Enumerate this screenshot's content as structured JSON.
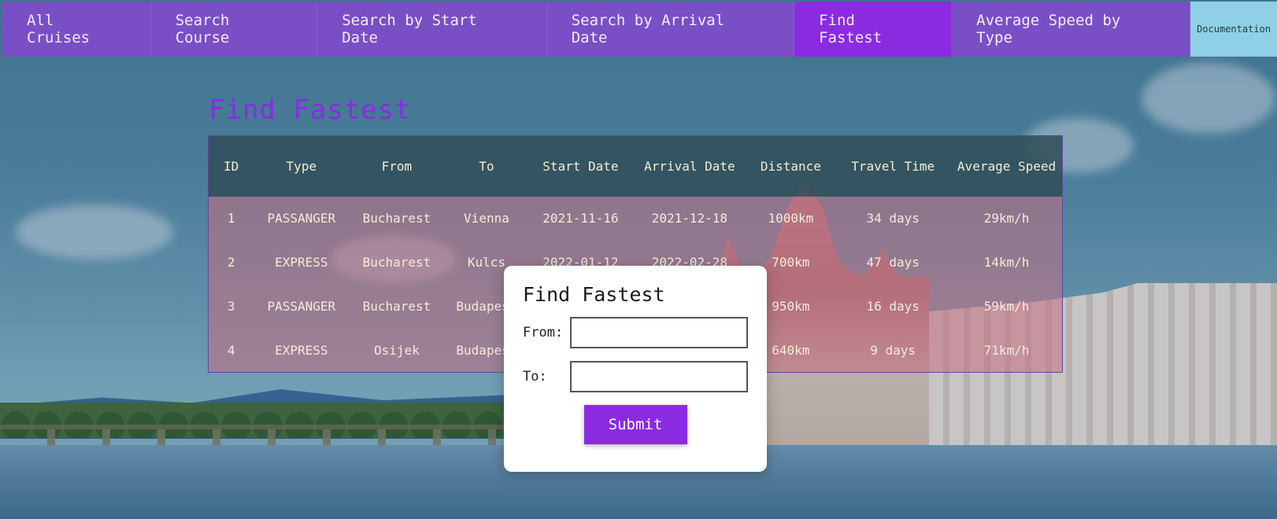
{
  "nav": {
    "items": [
      {
        "label": "All Cruises"
      },
      {
        "label": "Search Course"
      },
      {
        "label": "Search by Start Date"
      },
      {
        "label": "Search by Arrival Date"
      },
      {
        "label": "Find Fastest",
        "active": true
      },
      {
        "label": "Average Speed by Type"
      }
    ],
    "documentation_label": "Documentation"
  },
  "page": {
    "title": "Find Fastest"
  },
  "table": {
    "headers": [
      "ID",
      "Type",
      "From",
      "To",
      "Start Date",
      "Arrival Date",
      "Distance",
      "Travel Time",
      "Average Speed"
    ],
    "rows": [
      [
        "1",
        "PASSANGER",
        "Bucharest",
        "Vienna",
        "2021-11-16",
        "2021-12-18",
        "1000km",
        "34 days",
        "29km/h"
      ],
      [
        "2",
        "EXPRESS",
        "Bucharest",
        "Kulcs",
        "2022-01-12",
        "2022-02-28",
        "700km",
        "47 days",
        "14km/h"
      ],
      [
        "3",
        "PASSANGER",
        "Bucharest",
        "Budapest",
        "",
        "",
        "950km",
        "16 days",
        "59km/h"
      ],
      [
        "4",
        "EXPRESS",
        "Osijek",
        "Budapest",
        "",
        "",
        "640km",
        "9 days",
        "71km/h"
      ]
    ]
  },
  "modal": {
    "title": "Find Fastest",
    "from_label": "From:",
    "from_value": "",
    "to_label": "To:",
    "to_value": "",
    "submit_label": "Submit"
  },
  "colors": {
    "nav_bg": "#7a4fc6",
    "nav_active": "#8a2be2",
    "doc_button": "#8fd0e6",
    "title": "#8a2be2",
    "table_header": "#2f4c56",
    "table_row": "#c46e80",
    "submit": "#8a2be2"
  }
}
